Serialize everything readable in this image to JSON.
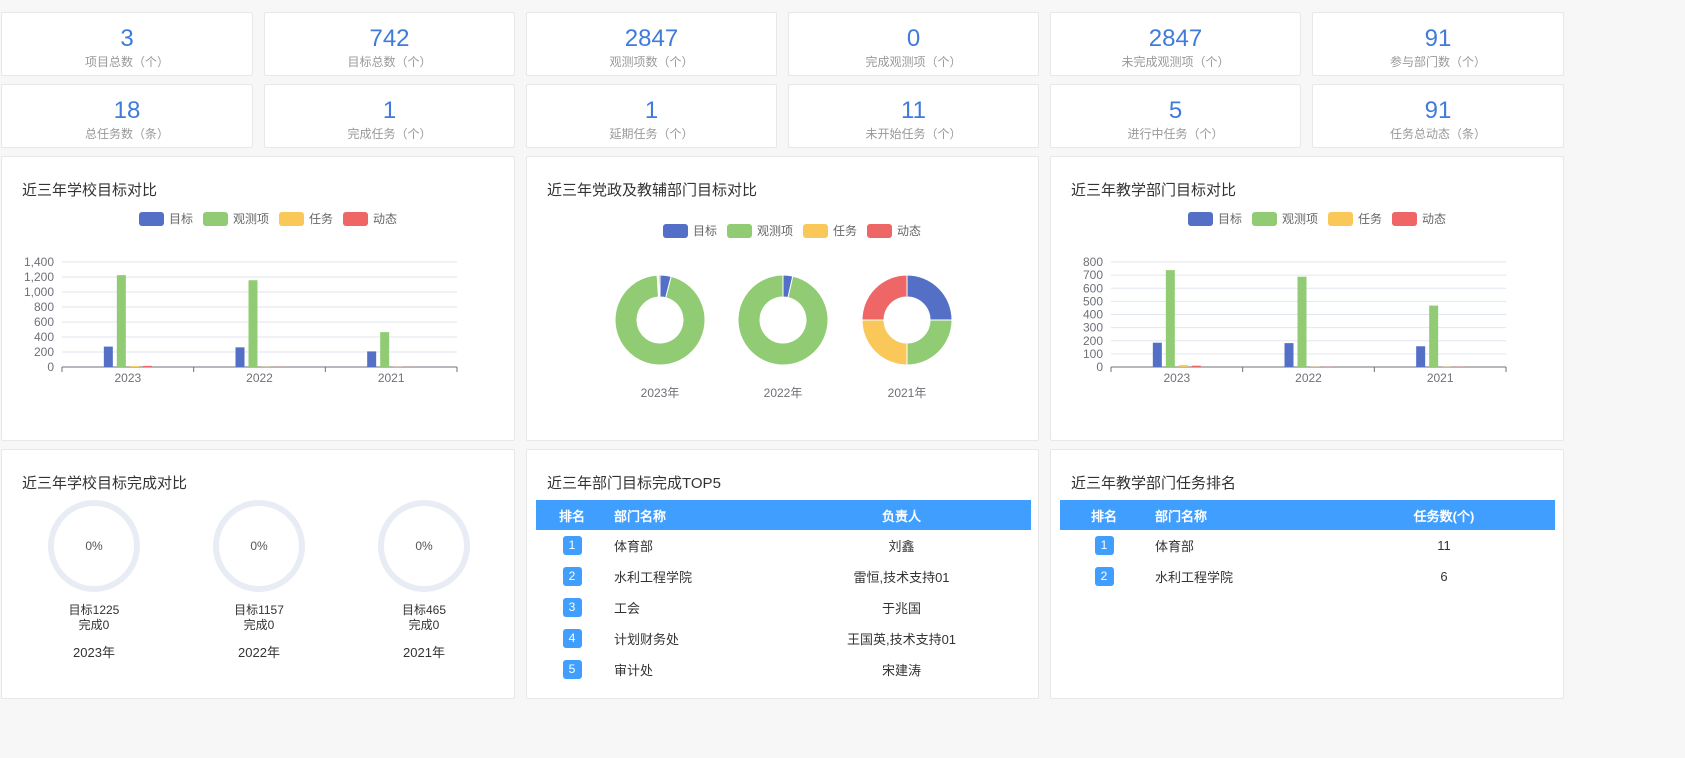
{
  "stats_row1": [
    {
      "value": "3",
      "label": "项目总数（个）"
    },
    {
      "value": "742",
      "label": "目标总数（个）"
    },
    {
      "value": "2847",
      "label": "观测项数（个）"
    },
    {
      "value": "0",
      "label": "完成观测项（个）"
    },
    {
      "value": "2847",
      "label": "未完成观测项（个）"
    },
    {
      "value": "91",
      "label": "参与部门数（个）"
    }
  ],
  "stats_row2": [
    {
      "value": "18",
      "label": "总任务数（条）"
    },
    {
      "value": "1",
      "label": "完成任务（个）"
    },
    {
      "value": "1",
      "label": "延期任务（个）"
    },
    {
      "value": "11",
      "label": "未开始任务（个）"
    },
    {
      "value": "5",
      "label": "进行中任务（个）"
    },
    {
      "value": "91",
      "label": "任务总动态（条）"
    }
  ],
  "colors": {
    "目标": "#5470c6",
    "观测项": "#91cc75",
    "任务": "#fac858",
    "动态": "#ee6666",
    "accent": "#409eff"
  },
  "legend": [
    "目标",
    "观测项",
    "任务",
    "动态"
  ],
  "panels": {
    "school": {
      "title": "近三年学校目标对比"
    },
    "party": {
      "title": "近三年党政及教辅部门目标对比"
    },
    "teach": {
      "title": "近三年教学部门目标对比"
    },
    "completion": {
      "title": "近三年学校目标完成对比"
    },
    "top5": {
      "title": "近三年部门目标完成TOP5"
    },
    "taskrank": {
      "title": "近三年教学部门任务排名"
    }
  },
  "chart_data": [
    {
      "type": "bar",
      "categories": [
        "2023",
        "2022",
        "2021"
      ],
      "ylim": [
        0,
        1400
      ],
      "yticks": [
        0,
        200,
        400,
        600,
        800,
        1000,
        1200,
        1400
      ],
      "ytick_labels": [
        "0",
        "200",
        "400",
        "600",
        "800",
        "1,000",
        "1,200",
        "1,400"
      ],
      "series": [
        {
          "name": "目标",
          "values": [
            272,
            262,
            208
          ]
        },
        {
          "name": "观测项",
          "values": [
            1225,
            1157,
            465
          ]
        },
        {
          "name": "任务",
          "values": [
            12,
            3,
            3
          ]
        },
        {
          "name": "动态",
          "values": [
            15,
            2,
            2
          ]
        }
      ],
      "grid": true,
      "legend_position": "top-center"
    },
    {
      "type": "pie",
      "variant": "donut",
      "categories": [
        "目标",
        "观测项",
        "任务",
        "动态"
      ],
      "charts": [
        {
          "label": "2023年",
          "values": [
            4,
            95,
            0.5,
            0.5
          ]
        },
        {
          "label": "2022年",
          "values": [
            3.5,
            96.5,
            0,
            0
          ]
        },
        {
          "label": "2021年",
          "values": [
            25,
            25,
            25,
            25
          ]
        }
      ],
      "legend_position": "top-center"
    },
    {
      "type": "bar",
      "categories": [
        "2023",
        "2022",
        "2021"
      ],
      "ylim": [
        0,
        800
      ],
      "yticks": [
        0,
        100,
        200,
        300,
        400,
        500,
        600,
        700,
        800
      ],
      "ytick_labels": [
        "0",
        "100",
        "200",
        "300",
        "400",
        "500",
        "600",
        "700",
        "800"
      ],
      "series": [
        {
          "name": "目标",
          "values": [
            185,
            182,
            158
          ]
        },
        {
          "name": "观测项",
          "values": [
            738,
            688,
            468
          ]
        },
        {
          "name": "任务",
          "values": [
            15,
            2,
            2
          ]
        },
        {
          "name": "动态",
          "values": [
            10,
            2,
            2
          ]
        }
      ],
      "grid": true,
      "legend_position": "top-center"
    }
  ],
  "completion": [
    {
      "percent": "0%",
      "target": "目标1225",
      "done": "完成0",
      "year": "2023年"
    },
    {
      "percent": "0%",
      "target": "目标1157",
      "done": "完成0",
      "year": "2022年"
    },
    {
      "percent": "0%",
      "target": "目标465",
      "done": "完成0",
      "year": "2021年"
    }
  ],
  "top5": {
    "headers": [
      "排名",
      "部门名称",
      "负责人"
    ],
    "rows": [
      {
        "rank": "1",
        "dept": "体育部",
        "owner": "刘鑫"
      },
      {
        "rank": "2",
        "dept": "水利工程学院",
        "owner": "雷恒,技术支持01"
      },
      {
        "rank": "3",
        "dept": "工会",
        "owner": "于兆国"
      },
      {
        "rank": "4",
        "dept": "计划财务处",
        "owner": "王国英,技术支持01"
      },
      {
        "rank": "5",
        "dept": "审计处",
        "owner": "宋建涛"
      }
    ]
  },
  "taskrank": {
    "headers": [
      "排名",
      "部门名称",
      "任务数(个)"
    ],
    "rows": [
      {
        "rank": "1",
        "dept": "体育部",
        "count": "11"
      },
      {
        "rank": "2",
        "dept": "水利工程学院",
        "count": "6"
      }
    ]
  }
}
